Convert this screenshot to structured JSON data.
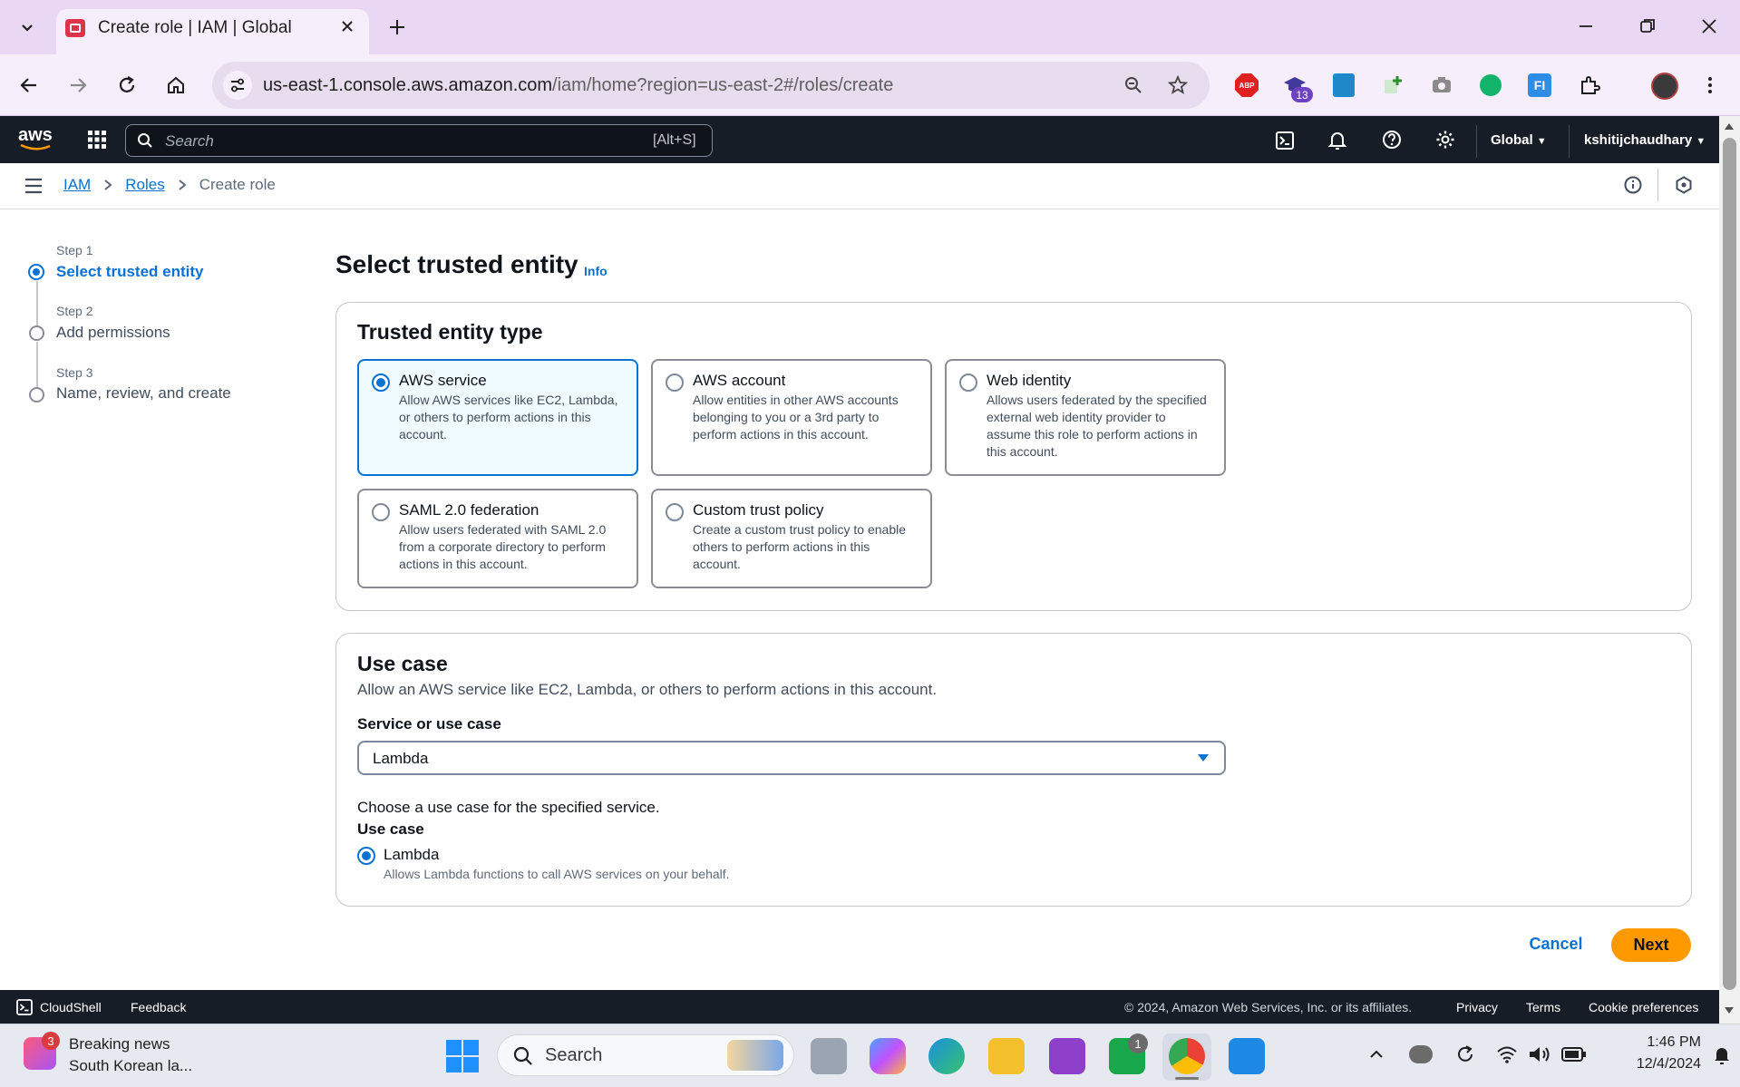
{
  "browser": {
    "tab_title": "Create role | IAM | Global",
    "url_host": "us-east-1.console.aws.amazon.com",
    "url_path": "/iam/home?region=us-east-2#/roles/create",
    "extension_badge": "13"
  },
  "aws_nav": {
    "logo": "aws",
    "search_placeholder": "Search",
    "search_shortcut": "[Alt+S]",
    "region": "Global",
    "user": "kshitijchaudhary"
  },
  "breadcrumb": {
    "items": [
      "IAM",
      "Roles"
    ],
    "current": "Create role"
  },
  "steps": [
    {
      "label": "Step 1",
      "name": "Select trusted entity",
      "active": true
    },
    {
      "label": "Step 2",
      "name": "Add permissions",
      "active": false
    },
    {
      "label": "Step 3",
      "name": "Name, review, and create",
      "active": false
    }
  ],
  "main": {
    "title": "Select trusted entity",
    "info": "Info",
    "trusted_entity": {
      "heading": "Trusted entity type",
      "options": [
        {
          "title": "AWS service",
          "desc": "Allow AWS services like EC2, Lambda, or others to perform actions in this account.",
          "selected": true
        },
        {
          "title": "AWS account",
          "desc": "Allow entities in other AWS accounts belonging to you or a 3rd party to perform actions in this account.",
          "selected": false
        },
        {
          "title": "Web identity",
          "desc": "Allows users federated by the specified external web identity provider to assume this role to perform actions in this account.",
          "selected": false
        },
        {
          "title": "SAML 2.0 federation",
          "desc": "Allow users federated with SAML 2.0 from a corporate directory to perform actions in this account.",
          "selected": false
        },
        {
          "title": "Custom trust policy",
          "desc": "Create a custom trust policy to enable others to perform actions in this account.",
          "selected": false
        }
      ]
    },
    "use_case": {
      "heading": "Use case",
      "description": "Allow an AWS service like EC2, Lambda, or others to perform actions in this account.",
      "service_label": "Service or use case",
      "service_value": "Lambda",
      "choose_text": "Choose a use case for the specified service.",
      "use_case_label": "Use case",
      "option_title": "Lambda",
      "option_desc": "Allows Lambda functions to call AWS services on your behalf."
    },
    "buttons": {
      "cancel": "Cancel",
      "next": "Next"
    }
  },
  "footer": {
    "cloudshell": "CloudShell",
    "feedback": "Feedback",
    "copyright": "© 2024, Amazon Web Services, Inc. or its affiliates.",
    "privacy": "Privacy",
    "terms": "Terms",
    "cookie": "Cookie preferences"
  },
  "taskbar": {
    "news_badge": "3",
    "news_title": "Breaking news",
    "news_sub": "South Korean la...",
    "search_label": "Search",
    "xbox_badge": "1",
    "time": "1:46 PM",
    "date": "12/4/2024"
  },
  "colors": {
    "accent": "#0972d3",
    "primary_button": "#ff9900",
    "nav_bg": "#161d26",
    "tabbar_bg": "#e9d7f3"
  }
}
